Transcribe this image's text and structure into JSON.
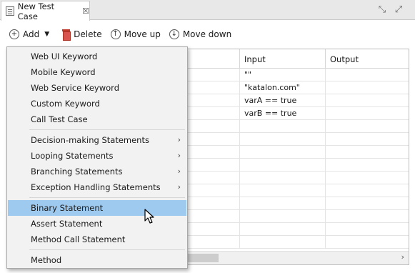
{
  "tab": {
    "title": "New Test Case",
    "close": "☒"
  },
  "toolbar": {
    "add": "Add",
    "delete": "Delete",
    "move_up": "Move up",
    "move_down": "Move down"
  },
  "table": {
    "columns": [
      "Input",
      "Output"
    ],
    "rows": [
      {
        "input": "\"\"",
        "output": ""
      },
      {
        "input": "\"katalon.com\"",
        "output": ""
      },
      {
        "input": "varA == true",
        "output": ""
      },
      {
        "input": "varB == true",
        "output": ""
      }
    ]
  },
  "menu": {
    "items": [
      "Web UI Keyword",
      "Mobile Keyword",
      "Web Service Keyword",
      "Custom Keyword",
      "Call Test Case",
      "Decision-making Statements",
      "Looping Statements",
      "Branching Statements",
      "Exception Handling Statements",
      "Binary Statement",
      "Assert Statement",
      "Method Call Statement",
      "Method"
    ],
    "selected": "Binary Statement"
  }
}
